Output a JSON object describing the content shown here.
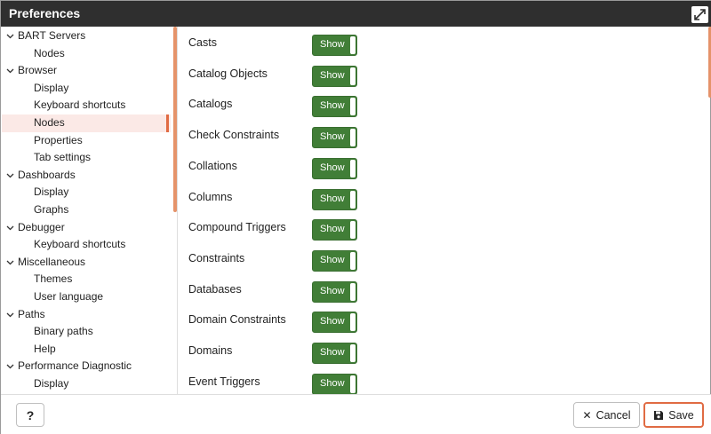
{
  "window": {
    "title": "Preferences"
  },
  "tree": [
    {
      "label": "BART Servers",
      "type": "group"
    },
    {
      "label": "Nodes",
      "type": "leaf"
    },
    {
      "label": "Browser",
      "type": "group"
    },
    {
      "label": "Display",
      "type": "leaf"
    },
    {
      "label": "Keyboard shortcuts",
      "type": "leaf"
    },
    {
      "label": "Nodes",
      "type": "leaf",
      "selected": true
    },
    {
      "label": "Properties",
      "type": "leaf"
    },
    {
      "label": "Tab settings",
      "type": "leaf"
    },
    {
      "label": "Dashboards",
      "type": "group"
    },
    {
      "label": "Display",
      "type": "leaf"
    },
    {
      "label": "Graphs",
      "type": "leaf"
    },
    {
      "label": "Debugger",
      "type": "group"
    },
    {
      "label": "Keyboard shortcuts",
      "type": "leaf"
    },
    {
      "label": "Miscellaneous",
      "type": "group"
    },
    {
      "label": "Themes",
      "type": "leaf"
    },
    {
      "label": "User language",
      "type": "leaf"
    },
    {
      "label": "Paths",
      "type": "group"
    },
    {
      "label": "Binary paths",
      "type": "leaf"
    },
    {
      "label": "Help",
      "type": "leaf"
    },
    {
      "label": "Performance Diagnostic",
      "type": "group"
    },
    {
      "label": "Display",
      "type": "leaf"
    }
  ],
  "preferences": [
    {
      "label": "Casts",
      "value": "Show"
    },
    {
      "label": "Catalog Objects",
      "value": "Show"
    },
    {
      "label": "Catalogs",
      "value": "Show"
    },
    {
      "label": "Check Constraints",
      "value": "Show"
    },
    {
      "label": "Collations",
      "value": "Show"
    },
    {
      "label": "Columns",
      "value": "Show"
    },
    {
      "label": "Compound Triggers",
      "value": "Show"
    },
    {
      "label": "Constraints",
      "value": "Show"
    },
    {
      "label": "Databases",
      "value": "Show"
    },
    {
      "label": "Domain Constraints",
      "value": "Show"
    },
    {
      "label": "Domains",
      "value": "Show"
    },
    {
      "label": "Event Triggers",
      "value": "Show"
    }
  ],
  "footer": {
    "help_label": "?",
    "cancel_label": "Cancel",
    "save_label": "Save"
  },
  "colors": {
    "titlebar": "#2f2f2f",
    "toggle_on": "#417e37",
    "accent": "#e06b43",
    "selected_bg": "#fbe9e6"
  }
}
